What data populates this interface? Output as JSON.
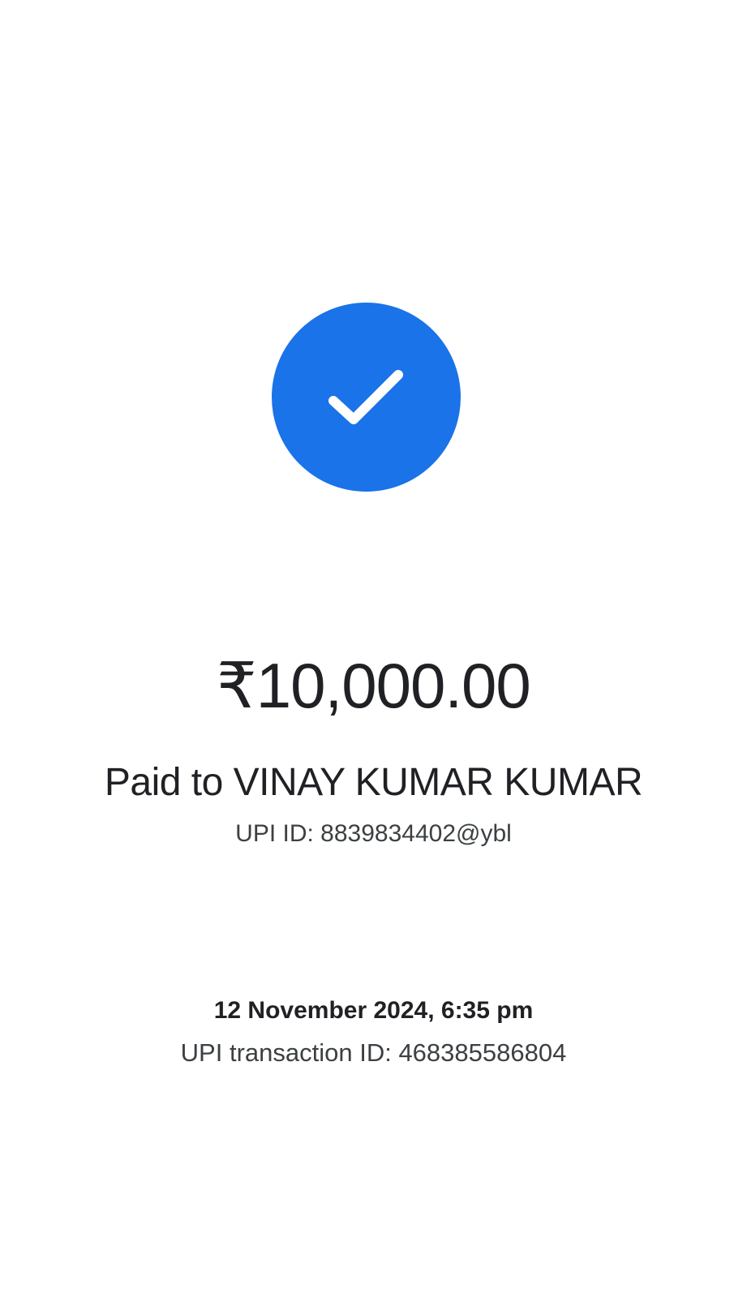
{
  "status": {
    "icon": "check-circle-icon",
    "accent_color": "#1a73e8"
  },
  "payment": {
    "amount": "₹10,000.00",
    "paid_to": "Paid to VINAY KUMAR KUMAR",
    "upi_id": "UPI ID: 8839834402@ybl"
  },
  "transaction": {
    "datetime": "12 November 2024, 6:35 pm",
    "upi_transaction_id": "UPI transaction ID: 468385586804"
  }
}
